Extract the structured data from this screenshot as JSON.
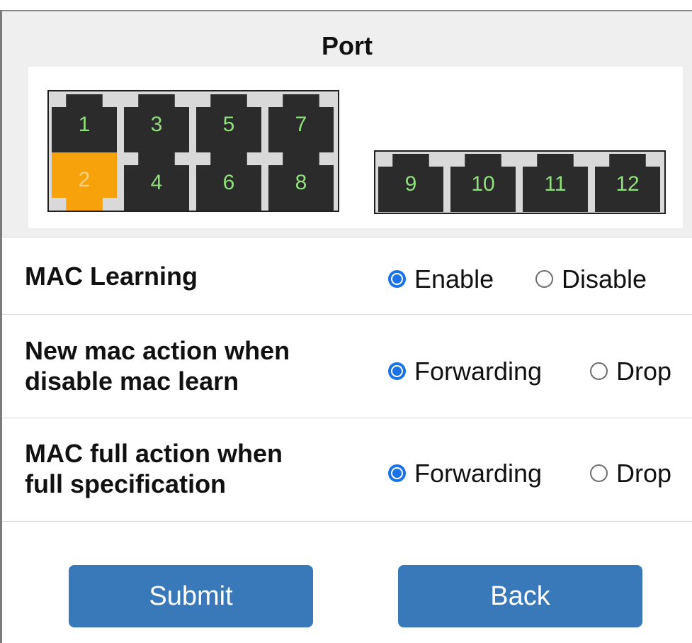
{
  "port_section": {
    "title": "Port",
    "group_a": [
      {
        "label": "1",
        "selected": false
      },
      {
        "label": "3",
        "selected": false
      },
      {
        "label": "5",
        "selected": false
      },
      {
        "label": "7",
        "selected": false
      },
      {
        "label": "2",
        "selected": true
      },
      {
        "label": "4",
        "selected": false
      },
      {
        "label": "6",
        "selected": false
      },
      {
        "label": "8",
        "selected": false
      }
    ],
    "group_b": [
      {
        "label": "9",
        "selected": false
      },
      {
        "label": "10",
        "selected": false
      },
      {
        "label": "11",
        "selected": false
      },
      {
        "label": "12",
        "selected": false
      }
    ],
    "colors": {
      "port_default": "#2b2b2b",
      "port_selected": "#f7a10b",
      "port_number": "#8fe07a"
    }
  },
  "settings": [
    {
      "label": "MAC Learning",
      "options": [
        {
          "label": "Enable",
          "checked": true
        },
        {
          "label": "Disable",
          "checked": false
        }
      ]
    },
    {
      "label_lines": [
        "New mac action when",
        "disable mac learn"
      ],
      "options": [
        {
          "label": "Forwarding",
          "checked": true
        },
        {
          "label": "Drop",
          "checked": false
        }
      ]
    },
    {
      "label_lines": [
        "MAC full action when",
        "full specification"
      ],
      "options": [
        {
          "label": "Forwarding",
          "checked": true
        },
        {
          "label": "Drop",
          "checked": false
        }
      ]
    }
  ],
  "buttons": {
    "submit": "Submit",
    "back": "Back",
    "color": "#3a79b9"
  }
}
